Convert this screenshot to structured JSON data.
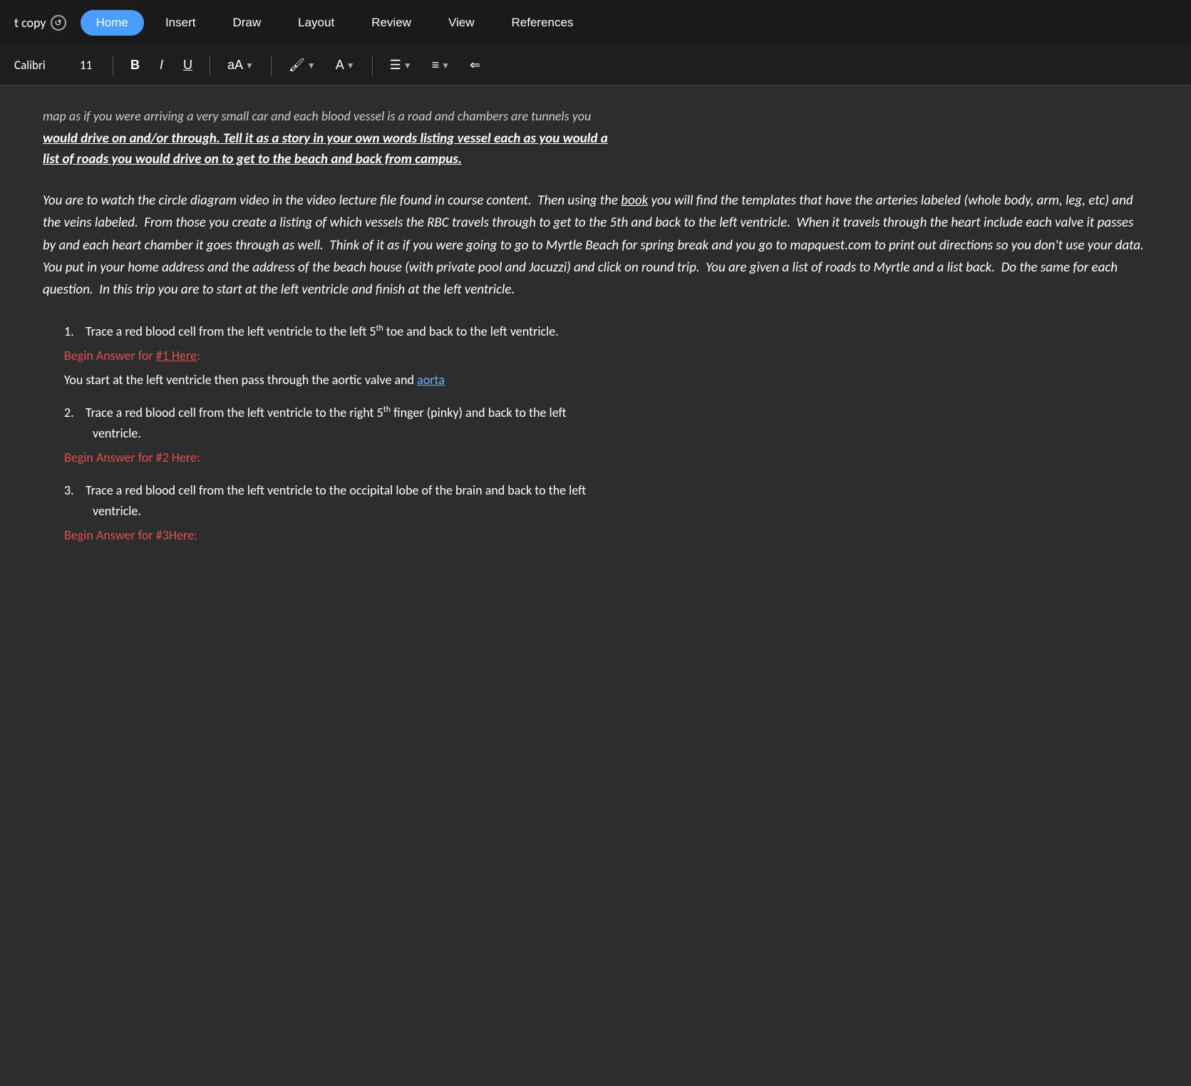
{
  "titlebar": {
    "copy_label": "t copy",
    "tabs": [
      {
        "id": "home",
        "label": "Home",
        "active": true
      },
      {
        "id": "insert",
        "label": "Insert",
        "active": false
      },
      {
        "id": "draw",
        "label": "Draw",
        "active": false
      },
      {
        "id": "layout",
        "label": "Layout",
        "active": false
      },
      {
        "id": "review",
        "label": "Review",
        "active": false
      },
      {
        "id": "view",
        "label": "View",
        "active": false
      },
      {
        "id": "references",
        "label": "References",
        "active": false
      }
    ]
  },
  "toolbar": {
    "font_name": "Calibri",
    "font_size": "11",
    "bold_label": "B",
    "italic_label": "I",
    "underline_label": "U",
    "font_color_label": "aA",
    "highlight_label": "▼",
    "font_color_arrow": "▼",
    "list_label": "≡",
    "indent_label": "≡",
    "align_label": "⇐"
  },
  "document": {
    "partial_line": "map as if you were arriving a very small car and each blood vessel is a road and chambers are tunnels you",
    "bold_line1": "would drive on and/or through. Tell it as a story in your own words listing vessel each as you would a",
    "bold_line2": "list of roads you would drive on to get to the beach and back from campus.",
    "main_paragraph": "You are to watch the circle diagram video in the video lecture file found in course content.  Then using the book you will find the templates that have the arteries labeled (whole body, arm, leg, etc) and the veins labeled.  From those you create a listing of which vessels the RBC travels through to get to the 5th and back to the left ventricle.  When it travels through the heart include each valve it passes by and each heart chamber it goes through as well.  Think of it as if you were going to go to Myrtle Beach for spring break and you go to mapquest.com to print out directions so you don't use your data.  You put in your home address and the address of the beach house (with private pool and Jacuzzi) and click on round trip.  You are given a list of roads to Myrtle and a list back.  Do the same for each question.  In this trip you are to start at the left ventricle and finish at the left ventricle.",
    "questions": [
      {
        "number": "1.",
        "text": "Trace a red blood cell from the left ventricle to the left 5",
        "superscript": "th",
        "text2": " toe and back to the left ventricle.",
        "answer_label": "Begin Answer for #1 Here:",
        "answer_underlined_part": "#1 Here",
        "has_answer": true,
        "answer_text": "You start at the left ventricle then pass through the aortic valve and ",
        "answer_link": "aorta"
      },
      {
        "number": "2.",
        "text": "Trace a red blood cell from the left ventricle to the right 5",
        "superscript": "th",
        "text2": " finger (pinky) and back to the left",
        "text3": "ventricle.",
        "answer_label": "Begin Answer for #2 Here:",
        "has_answer": false
      },
      {
        "number": "3.",
        "text": "Trace a red blood cell from the left ventricle to the occipital lobe of the brain and back to the left",
        "text2": "ventricle.",
        "answer_label": "Begin Answer for #3Here:",
        "has_answer": false
      }
    ]
  }
}
